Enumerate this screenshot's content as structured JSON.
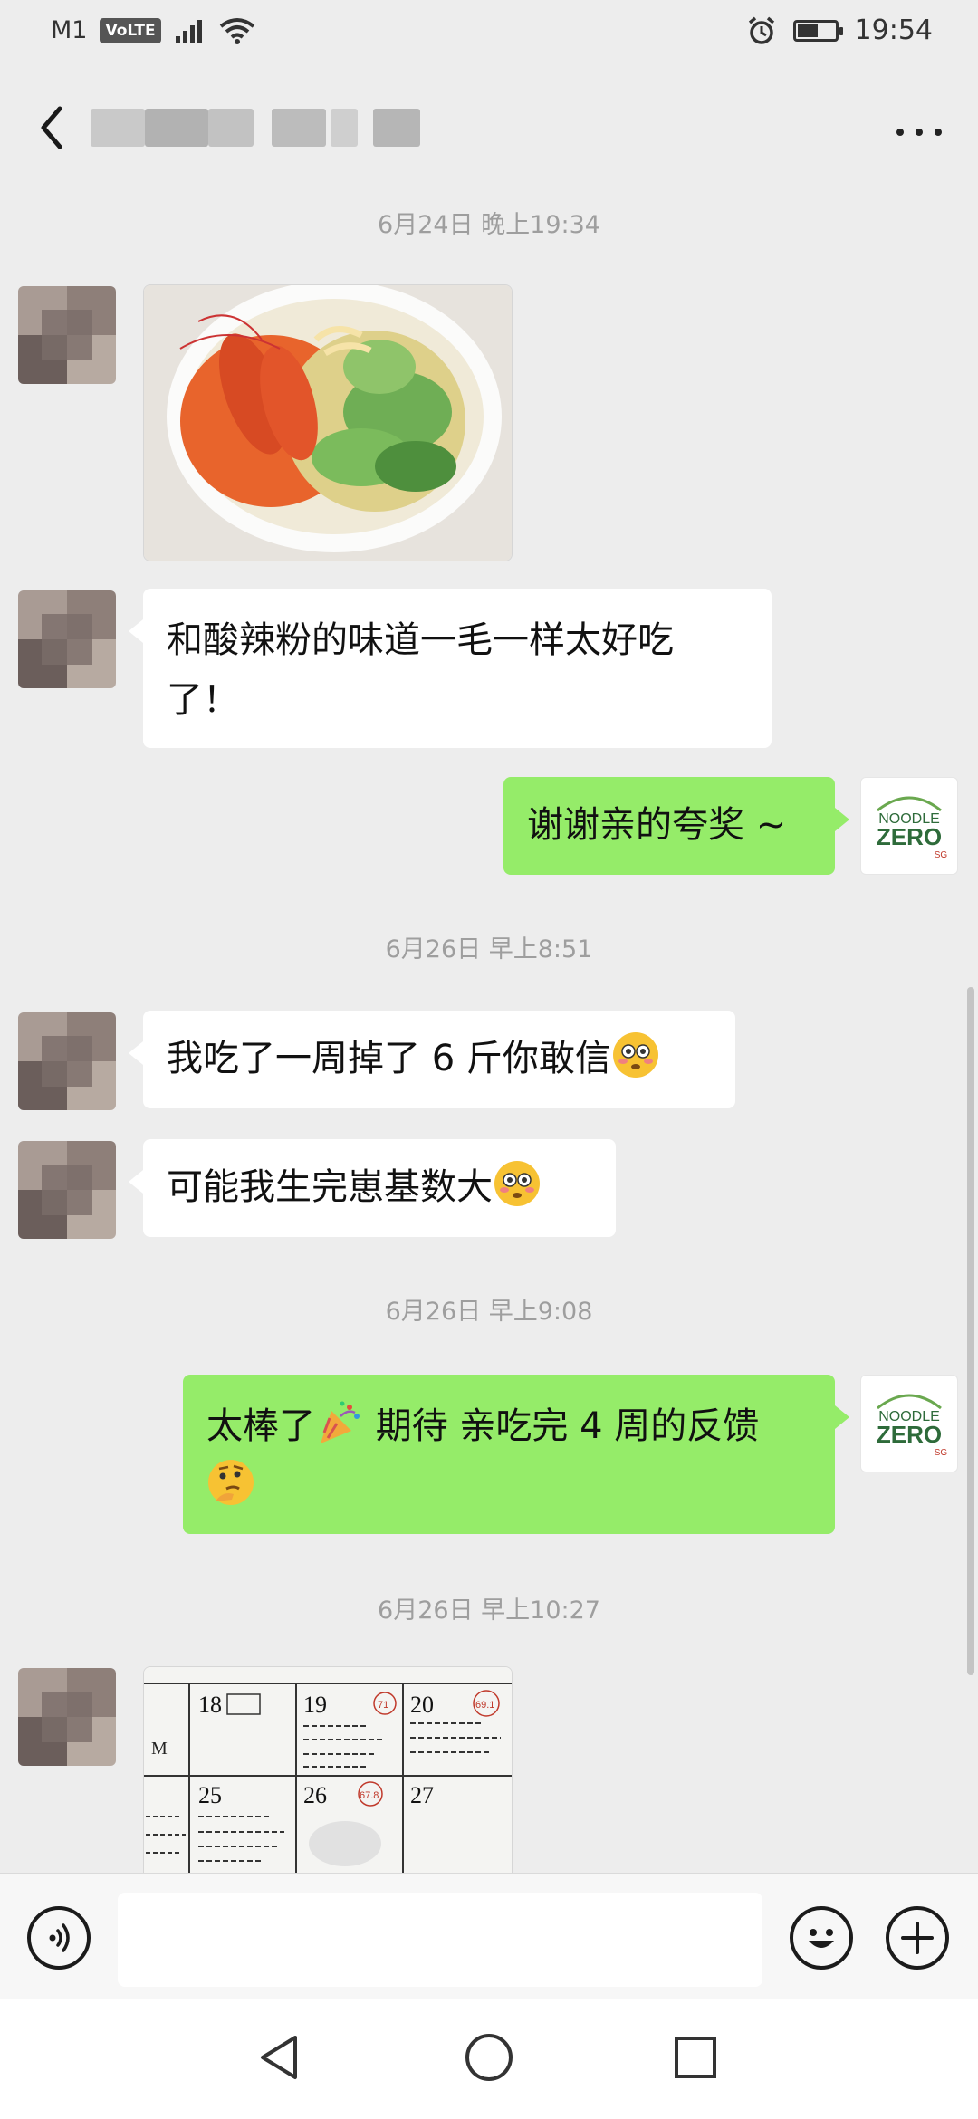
{
  "status_bar": {
    "carrier": "M1",
    "volte": "VoLTE",
    "time": "19:54"
  },
  "chat": {
    "title": "",
    "more_icon": "more-dots-icon",
    "back_icon": "chevron-left-icon"
  },
  "messages": {
    "ts1": "6月24日 晚上19:34",
    "m2_line1": "和酸辣粉的味道一毛一样太好吃",
    "m2_line2": "了！",
    "m3": "谢谢亲的夸奖 ~",
    "ts2": "6月26日 早上8:51",
    "m4": "我吃了一周掉了 6 斤你敢信",
    "m5": "可能我生完崽基数大",
    "ts3": "6月26日 早上9:08",
    "m6": "太棒了",
    "m6_b": " 期待 亲吃完 4 周的反馈",
    "ts4": "6月26日 早上10:27"
  },
  "brand": {
    "line1": "NOODLE",
    "line2": "ZERO",
    "line3": "SG",
    "color": "#2e6b3a"
  },
  "calendar": {
    "d18": "18",
    "d19": "19",
    "d20": "20",
    "d25": "25",
    "d26": "26",
    "d27": "27",
    "w19": "71",
    "w20": "69.1",
    "w26": "67.8",
    "left_mark": "M"
  },
  "input": {
    "placeholder": "",
    "voice_icon": "voice-icon",
    "emoji_icon": "emoji-icon",
    "plus_icon": "plus-icon"
  },
  "colors": {
    "incoming_bubble": "#ffffff",
    "outgoing_bubble": "#95ec69",
    "background": "#ededed"
  }
}
